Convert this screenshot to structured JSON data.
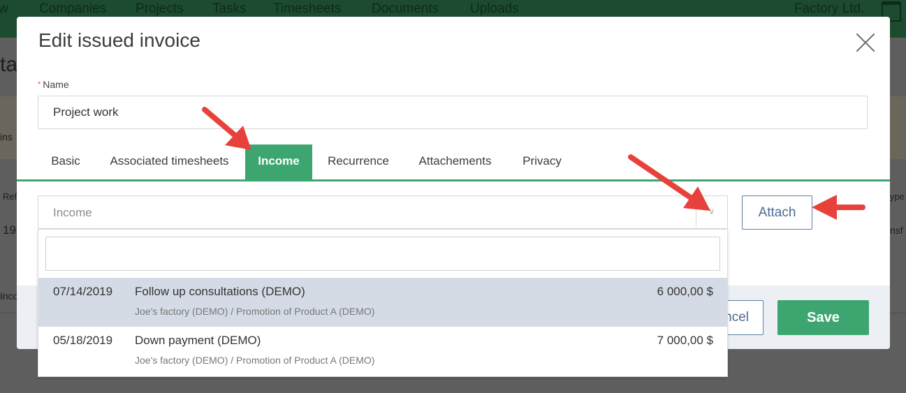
{
  "app": {
    "nav_items": [
      "w",
      "Companies",
      "Projects",
      "Tasks",
      "Timesheets",
      "Documents",
      "Uploads"
    ],
    "company": "Factory Ltd.",
    "bg_fragments": [
      "tai",
      "ins",
      "Ref",
      "19",
      "Inco",
      "ype",
      "nsf"
    ]
  },
  "modal": {
    "title": "Edit issued invoice",
    "name_label": "Name",
    "required_mark": "*",
    "name_value": "Project work",
    "tabs": [
      "Basic",
      "Associated timesheets",
      "Income",
      "Recurrence",
      "Attachements",
      "Privacy"
    ],
    "active_tab": "Income",
    "income_placeholder": "Income",
    "attach_label": "Attach",
    "cancel_label": "ncel",
    "save_label": "Save"
  },
  "dropdown": {
    "search_value": "",
    "options": [
      {
        "date": "07/14/2019",
        "title": "Follow up consultations (DEMO)",
        "amount": "6 000,00 $",
        "subtitle": "Joe's factory (DEMO) / Promotion of Product A (DEMO)",
        "highlighted": true
      },
      {
        "date": "05/18/2019",
        "title": "Down payment (DEMO)",
        "amount": "7 000,00 $",
        "subtitle": "Joe's factory (DEMO) / Promotion of Product A (DEMO)",
        "highlighted": false
      }
    ]
  },
  "colors": {
    "accent": "#3da670",
    "annotation_arrow": "#e8413b",
    "highlight_row": "#d5dbe4",
    "link_button": "#4a6b90"
  },
  "icons": [
    "close-icon",
    "chevron-down-icon",
    "calendar-icon",
    "annotation-arrow"
  ]
}
